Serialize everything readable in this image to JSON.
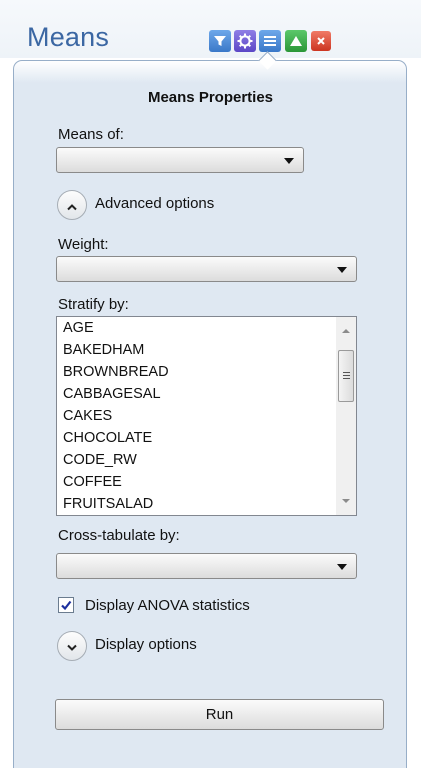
{
  "header": {
    "title": "Means",
    "buttons": [
      {
        "icon": "filter-icon",
        "color": "#4a86d4"
      },
      {
        "icon": "gear-icon",
        "color": "#6a5acd"
      },
      {
        "icon": "list-icon",
        "color": "#3f7ed2"
      },
      {
        "icon": "triangle-up-icon",
        "color": "#2f9a3a"
      },
      {
        "icon": "close-icon",
        "color": "#d9402b"
      }
    ]
  },
  "properties": {
    "heading": "Means Properties",
    "means_of_label": "Means of:",
    "means_of_value": "",
    "advanced_options_label": "Advanced options",
    "weight_label": "Weight:",
    "weight_value": "",
    "stratify_label": "Stratify by:",
    "stratify_items": [
      "AGE",
      "BAKEDHAM",
      "BROWNBREAD",
      "CABBAGESAL",
      "CAKES",
      "CHOCOLATE",
      "CODE_RW",
      "COFFEE",
      "FRUITSALAD"
    ],
    "crosstab_label": "Cross-tabulate by:",
    "crosstab_value": "",
    "anova_label": "Display ANOVA statistics",
    "anova_checked": true,
    "display_options_label": "Display options",
    "run_label": "Run"
  }
}
